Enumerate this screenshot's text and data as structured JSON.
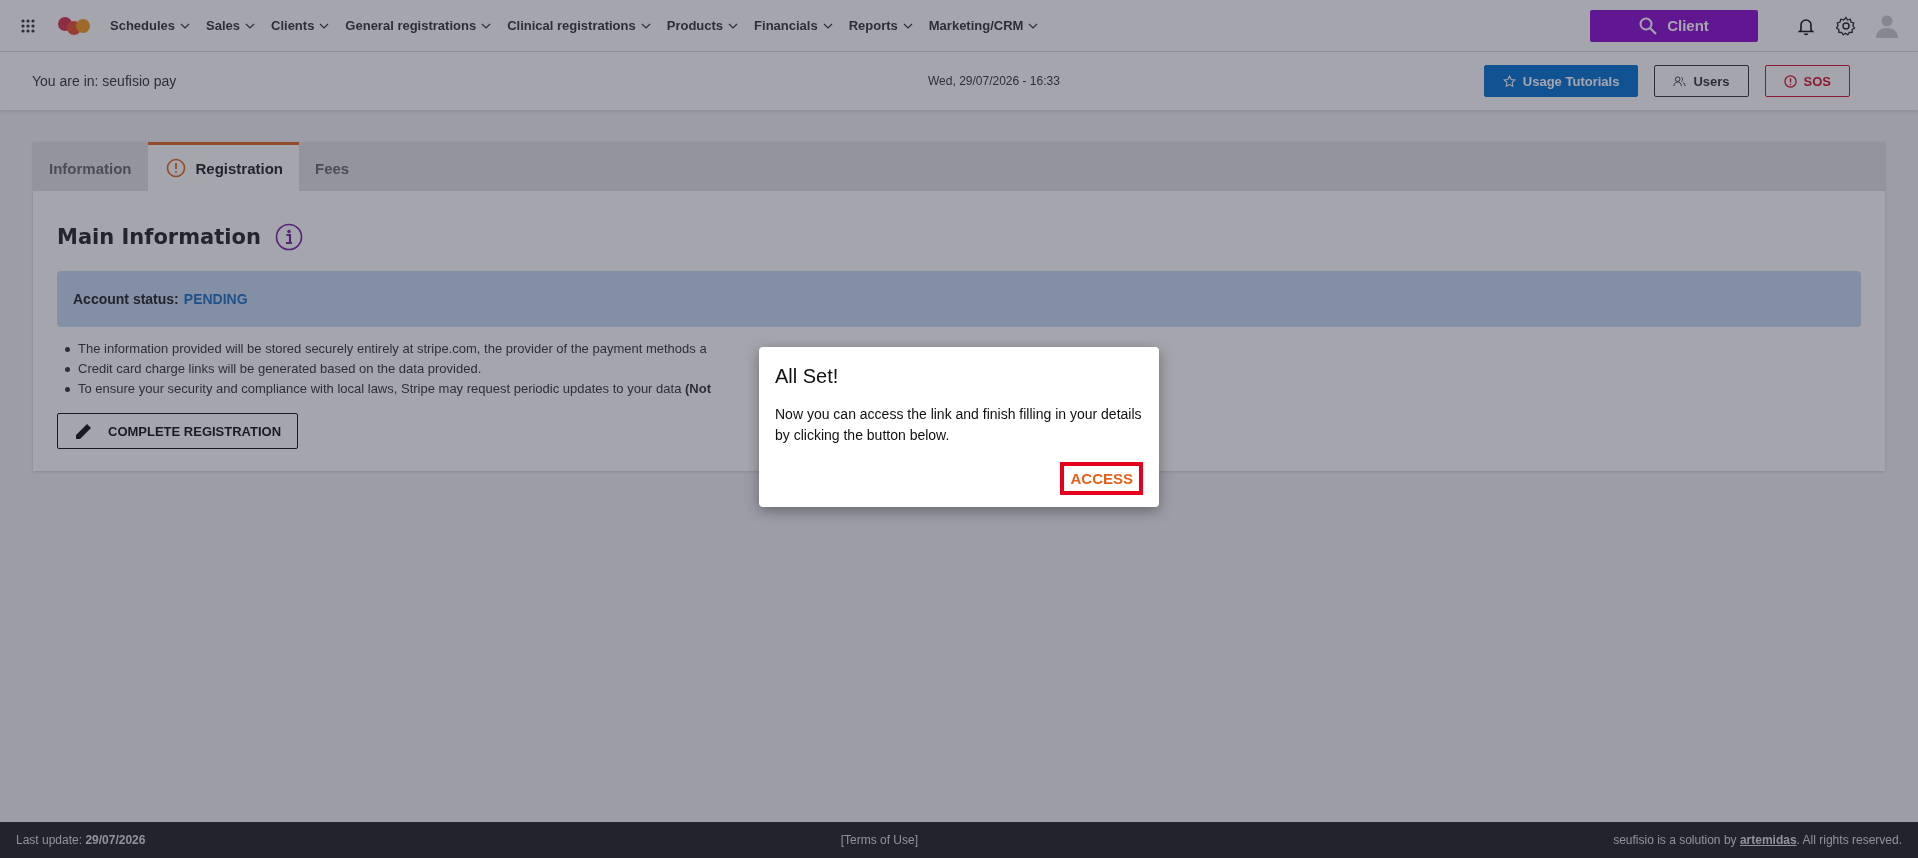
{
  "nav": {
    "items": [
      {
        "label": "Schedules"
      },
      {
        "label": "Sales"
      },
      {
        "label": "Clients"
      },
      {
        "label": "General registrations"
      },
      {
        "label": "Clinical registrations"
      },
      {
        "label": "Products"
      },
      {
        "label": "Financials"
      },
      {
        "label": "Reports"
      },
      {
        "label": "Marketing/CRM"
      }
    ],
    "search_button": "Client"
  },
  "subheader": {
    "location": "You are in: seufisio pay",
    "datetime": "Wed, 29/07/2026 - 16:33",
    "buttons": [
      {
        "kind": "tutorials",
        "label": "Usage Tutorials"
      },
      {
        "kind": "users",
        "label": "Users"
      },
      {
        "kind": "sos",
        "label": "SOS"
      }
    ]
  },
  "tabs": [
    {
      "label": "Information",
      "selected": false,
      "warning": false
    },
    {
      "label": "Registration",
      "selected": true,
      "warning": true
    },
    {
      "label": "Fees",
      "selected": false,
      "warning": false
    }
  ],
  "section": {
    "title": "Main Information",
    "status_label": "Account status:",
    "status_value": "PENDING",
    "bullets": [
      "The information provided will be stored securely entirely at stripe.com, the provider of the payment methods a",
      "Credit card charge links will be generated based on the data provided.",
      "To ensure your security and compliance with local laws, Stripe may request periodic updates to your data **(Not**"
    ],
    "button": "COMPLETE REGISTRATION"
  },
  "dialog": {
    "title": "All Set!",
    "message": "Now you can access the link and finish filling in your details by clicking the button below.",
    "button": "ACCESS"
  },
  "footer": {
    "last_update": "Last update: **29/07/2026**",
    "terms": "[Terms of Use]",
    "credit_before": "seufisio is a solution by",
    "credit_link": "artemidas",
    "credit_after": ". All rights reserved."
  }
}
